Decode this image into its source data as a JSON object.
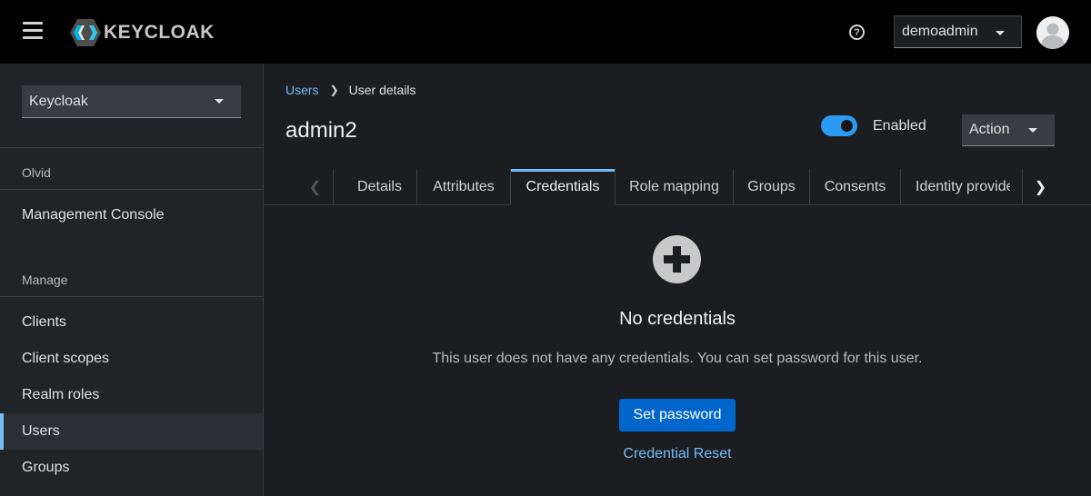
{
  "header": {
    "brand": "KEYCLOAK",
    "user_menu": "demoadmin"
  },
  "sidebar": {
    "realm_selector": "Keycloak",
    "section_olvid": "Olvid",
    "olvid_items": [
      {
        "label": "Management Console"
      }
    ],
    "section_manage": "Manage",
    "manage_items": [
      {
        "label": "Clients"
      },
      {
        "label": "Client scopes"
      },
      {
        "label": "Realm roles"
      },
      {
        "label": "Users",
        "active": true
      },
      {
        "label": "Groups"
      }
    ]
  },
  "breadcrumb": {
    "parent": "Users",
    "current": "User details"
  },
  "page": {
    "title": "admin2",
    "enabled_label": "Enabled",
    "enabled": true,
    "action_label": "Action"
  },
  "tabs": [
    {
      "label": "Details"
    },
    {
      "label": "Attributes"
    },
    {
      "label": "Credentials",
      "active": true
    },
    {
      "label": "Role mapping"
    },
    {
      "label": "Groups"
    },
    {
      "label": "Consents"
    },
    {
      "label": "Identity provider links"
    }
  ],
  "empty_state": {
    "icon": "add-circle-icon",
    "title": "No credentials",
    "body": "This user does not have any credentials. You can set password for this user.",
    "primary_action": "Set password",
    "secondary_action": "Credential Reset"
  },
  "colors": {
    "accent": "#73bcf7",
    "primary": "#0066cc",
    "toggle_on": "#2b9af3",
    "background": "#1b1d21",
    "header": "#000000"
  }
}
